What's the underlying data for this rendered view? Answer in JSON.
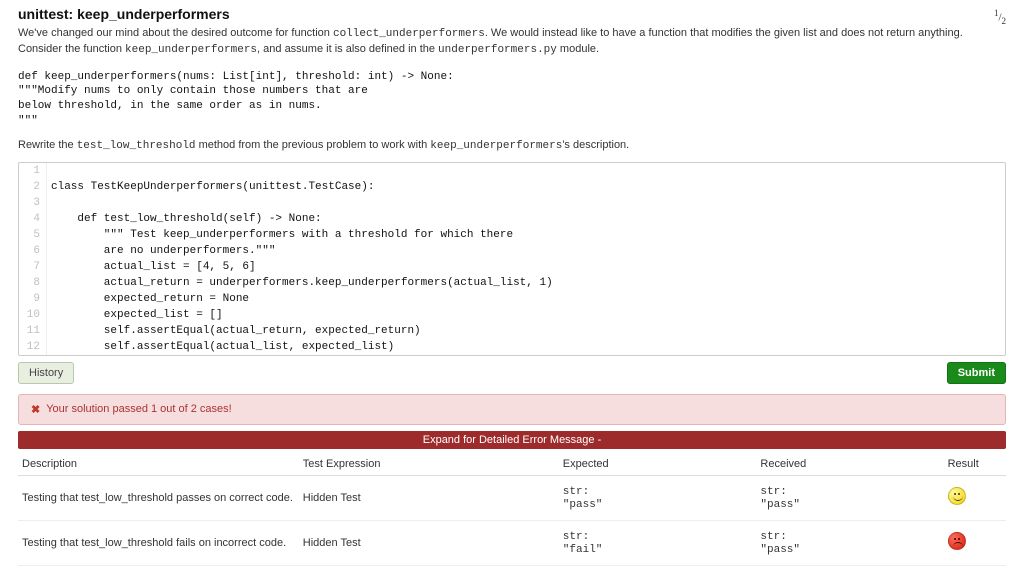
{
  "header": {
    "title": "unittest: keep_underperformers",
    "page_indicator_top": "1",
    "page_indicator_bottom": "2"
  },
  "intro": {
    "prefix": "We've changed our mind about the desired outcome for function ",
    "code1": "collect_underperformers",
    "mid": ". We would instead like to have a function that modifies the given list and does not return anything. Consider the function ",
    "code2": "keep_underperformers",
    "mid2": ", and assume it is also defined in the ",
    "code3": "underperformers.py",
    "suffix": " module."
  },
  "signature_block": "def keep_underperformers(nums: List[int], threshold: int) -> None:\n\"\"\"Modify nums to only contain those numbers that are\nbelow threshold, in the same order as in nums.\n\"\"\"",
  "rewrite": {
    "prefix": "Rewrite the ",
    "code1": "test_low_threshold",
    "mid": " method from the previous problem to work with ",
    "code2": "keep_underperformers",
    "suffix": "'s description."
  },
  "editor_lines": [
    "",
    "class TestKeepUnderperformers(unittest.TestCase):",
    "",
    "    def test_low_threshold(self) -> None:",
    "        \"\"\" Test keep_underperformers with a threshold for which there",
    "        are no underperformers.\"\"\"",
    "        actual_list = [4, 5, 6]",
    "        actual_return = underperformers.keep_underperformers(actual_list, 1)",
    "        expected_return = None",
    "        expected_list = []",
    "        self.assertEqual(actual_return, expected_return)",
    "        self.assertEqual(actual_list, expected_list)"
  ],
  "buttons": {
    "history": "History",
    "submit": "Submit"
  },
  "alert": {
    "message": "Your solution passed 1 out of 2 cases!"
  },
  "expand_bar": "Expand for Detailed Error Message -",
  "results": {
    "headers": {
      "desc": "Description",
      "test": "Test Expression",
      "expected": "Expected",
      "received": "Received",
      "result": "Result"
    },
    "rows": [
      {
        "desc": "Testing that test_low_threshold passes on correct code.",
        "test": "Hidden Test",
        "expected": "str:\n\"pass\"",
        "received": "str:\n\"pass\"",
        "emotion": "smile"
      },
      {
        "desc": "Testing that test_low_threshold fails on incorrect code.",
        "test": "Hidden Test",
        "expected": "str:\n\"fail\"",
        "received": "str:\n\"pass\"",
        "emotion": "frown"
      }
    ]
  }
}
